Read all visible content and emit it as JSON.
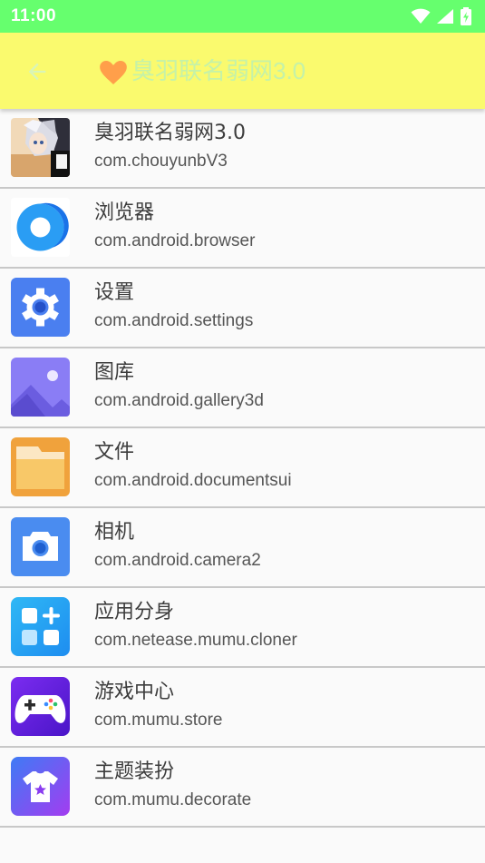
{
  "status_bar": {
    "time": "11:00",
    "icons": [
      "wifi-icon",
      "signal-icon",
      "battery-charging-icon"
    ],
    "background": "#66ff6e"
  },
  "app_bar": {
    "title": "臭羽联名弱网3.0",
    "back_icon": "arrow-back-icon",
    "heart_icon": "heart-icon",
    "background": "#fafa6e",
    "heart_color": "#ff9f4a"
  },
  "apps": [
    {
      "name": "臭羽联名弱网3.0",
      "package": "com.chouyunbV3",
      "icon": "anime-avatar-icon"
    },
    {
      "name": "浏览器",
      "package": "com.android.browser",
      "icon": "browser-icon"
    },
    {
      "name": "设置",
      "package": "com.android.settings",
      "icon": "settings-gear-icon"
    },
    {
      "name": "图库",
      "package": "com.android.gallery3d",
      "icon": "gallery-icon"
    },
    {
      "name": "文件",
      "package": "com.android.documentsui",
      "icon": "folder-icon"
    },
    {
      "name": "相机",
      "package": "com.android.camera2",
      "icon": "camera-icon"
    },
    {
      "name": "应用分身",
      "package": "com.netease.mumu.cloner",
      "icon": "app-cloner-icon"
    },
    {
      "name": "游戏中心",
      "package": "com.mumu.store",
      "icon": "gamepad-icon"
    },
    {
      "name": "主题装扮",
      "package": "com.mumu.decorate",
      "icon": "theme-shirt-icon"
    }
  ]
}
